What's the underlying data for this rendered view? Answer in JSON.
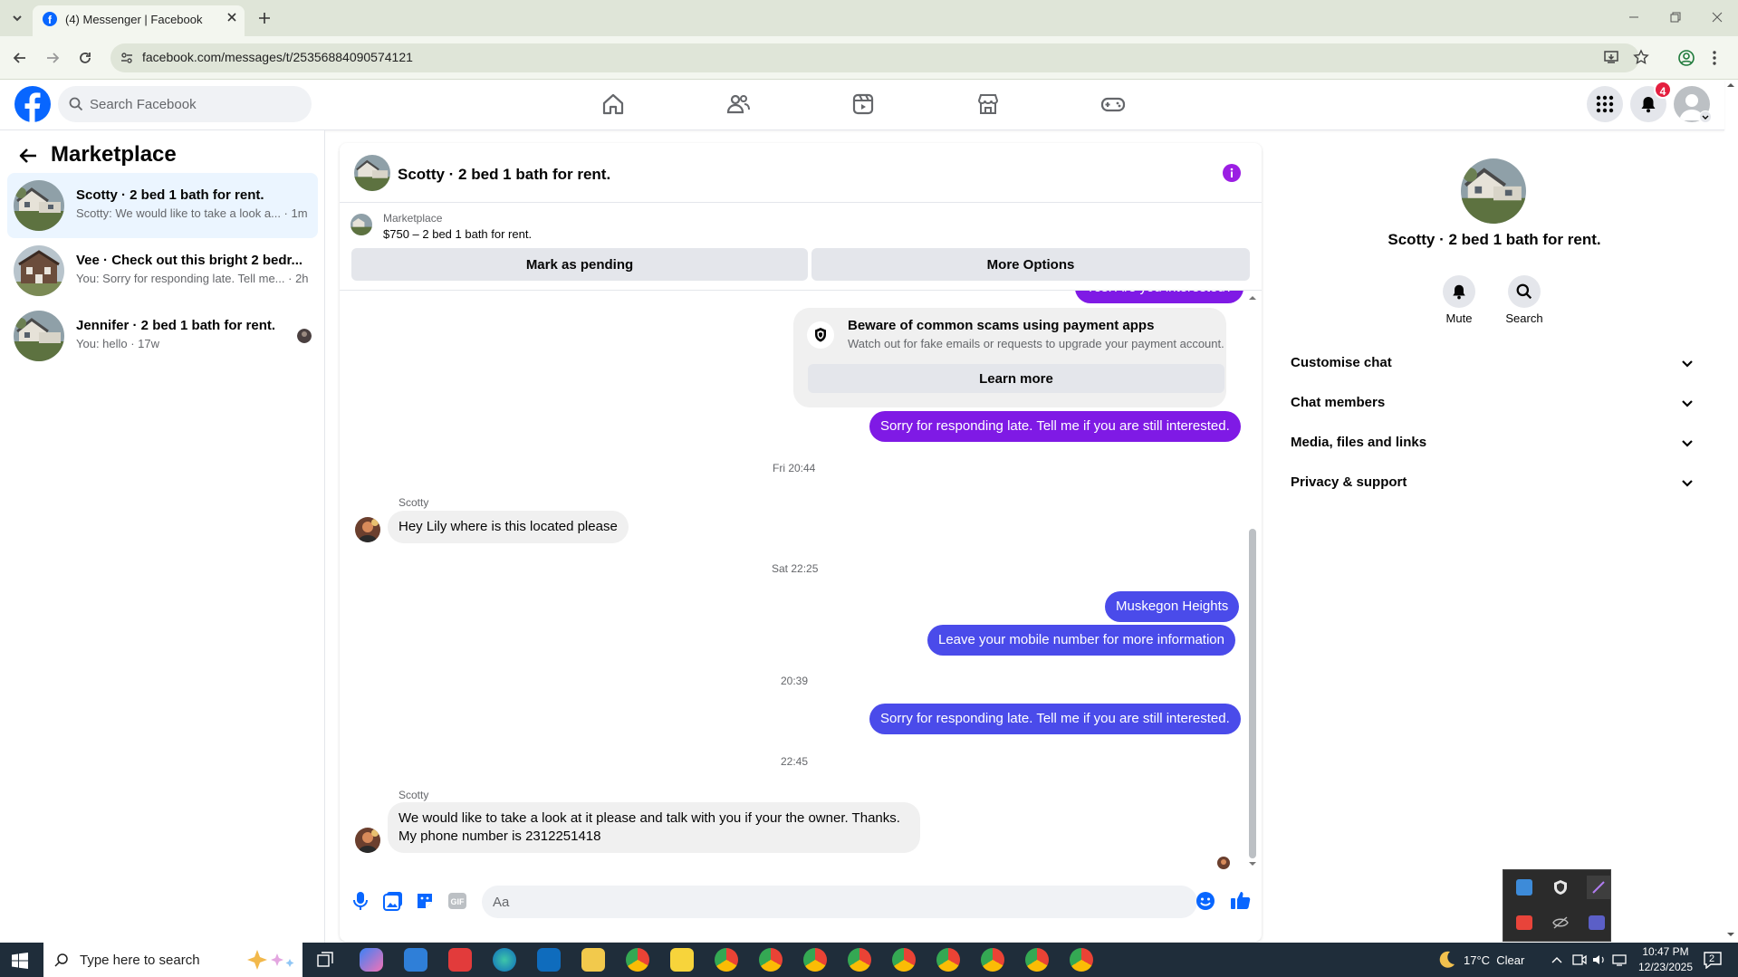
{
  "browser": {
    "tab_title": "(4) Messenger | Facebook",
    "url": "facebook.com/messages/t/25356884090574121"
  },
  "fb_header": {
    "search_placeholder": "Search Facebook",
    "notification_count": "4"
  },
  "left_panel": {
    "title": "Marketplace",
    "conversations": [
      {
        "title": "Scotty · 2 bed 1 bath for rent.",
        "preview": "Scotty: We would like to take a look a... · 1m"
      },
      {
        "title": "Vee · Check out this bright 2 bedr...",
        "preview": "You: Sorry for responding late. Tell me... · 2h"
      },
      {
        "title": "Jennifer · 2 bed 1 bath for rent.",
        "preview": "You: hello · 17w"
      }
    ]
  },
  "chat": {
    "title": "Scotty · 2 bed 1 bath for rent.",
    "marketplace_label": "Marketplace",
    "listing": "$750 – 2 bed 1 bath for rent.",
    "mark_pending_label": "Mark as pending",
    "more_options_label": "More Options",
    "partial_message": "Yes. Are you interested?",
    "scam_title": "Beware of common scams using payment apps",
    "scam_text": "Watch out for fake emails or requests to upgrade your payment account.",
    "learn_more_label": "Learn more",
    "messages": {
      "m1": "Sorry for responding late. Tell me if you are still interested.",
      "ts1": "Fri 20:44",
      "sender1": "Scotty",
      "m2": "Hey Lily where is this located please",
      "ts2": "Sat 22:25",
      "m3": "Muskegon Heights",
      "m4": "Leave your mobile number for more information",
      "ts3": "20:39",
      "m5": "Sorry for responding late. Tell me if you are still interested.",
      "ts4": "22:45",
      "sender2": "Scotty",
      "m6_line1": "We would like to take a look at it please and talk with you if your the owner. Thanks.",
      "m6_line2": "My phone number is 2312251418"
    },
    "composer_placeholder": "Aa"
  },
  "right_panel": {
    "title": "Scotty · 2 bed 1 bath for rent.",
    "mute_label": "Mute",
    "search_label": "Search",
    "sections": [
      "Customise chat",
      "Chat members",
      "Media, files and links",
      "Privacy & support"
    ]
  },
  "taskbar": {
    "search_placeholder": "Type here to search",
    "weather": "17°C  Clear",
    "time": "10:47 PM",
    "date": "12/23/2025",
    "notif_count": "2"
  },
  "colors": {
    "fb_blue": "#0866ff",
    "purple_bubble": "#7f1ae5",
    "blue_bubble": "#4a4bea",
    "badge_red": "#e41e3f"
  }
}
